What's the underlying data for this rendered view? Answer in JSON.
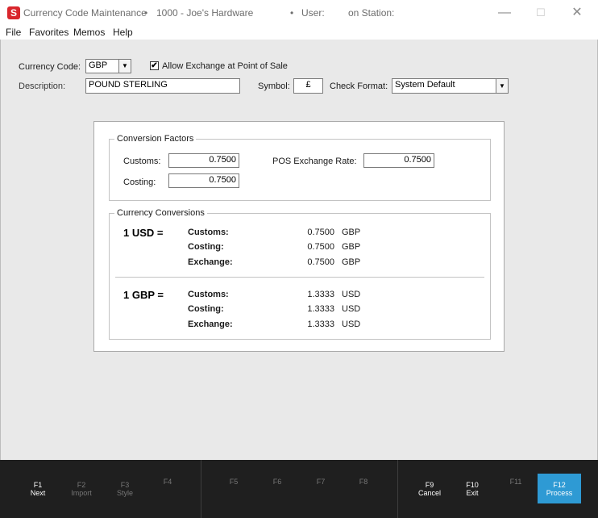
{
  "titlebar": {
    "app_icon": "S",
    "title": "Currency Code Maintenance",
    "sep1": "•",
    "store": "1000 - Joe's Hardware",
    "sep2": "•",
    "user_label": "User:",
    "station_label": "on Station:",
    "minimize": "—",
    "maximize": "☐",
    "close": "✕"
  },
  "menu": {
    "file": "File",
    "favorites": "Favorites",
    "memos": "Memos",
    "help": "Help"
  },
  "form": {
    "currency_code_label": "Currency Code:",
    "currency_code_value": "GBP",
    "allow_exchange_label": "Allow Exchange at Point of Sale",
    "allow_exchange_checked": "✔",
    "description_label": "Description:",
    "description_value": "POUND STERLING",
    "symbol_label": "Symbol:",
    "symbol_value": "£",
    "check_format_label": "Check Format:",
    "check_format_value": "System Default",
    "dropdown_arrow": "▼"
  },
  "conversion_factors": {
    "title": "Conversion Factors",
    "customs_label": "Customs:",
    "customs_value": "0.7500",
    "costing_label": "Costing:",
    "costing_value": "0.7500",
    "pos_rate_label": "POS Exchange Rate:",
    "pos_rate_value": "0.7500"
  },
  "currency_conversions": {
    "title": "Currency Conversions",
    "blocks": [
      {
        "heading": "1 USD =",
        "rows": [
          {
            "label": "Customs:",
            "value": "0.7500",
            "unit": "GBP"
          },
          {
            "label": "Costing:",
            "value": "0.7500",
            "unit": "GBP"
          },
          {
            "label": "Exchange:",
            "value": "0.7500",
            "unit": "GBP"
          }
        ]
      },
      {
        "heading": "1 GBP =",
        "rows": [
          {
            "label": "Customs:",
            "value": "1.3333",
            "unit": "USD"
          },
          {
            "label": "Costing:",
            "value": "1.3333",
            "unit": "USD"
          },
          {
            "label": "Exchange:",
            "value": "1.3333",
            "unit": "USD"
          }
        ]
      }
    ]
  },
  "fkeys": [
    {
      "key": "F1",
      "label": "Next"
    },
    {
      "key": "F2",
      "label": "Import"
    },
    {
      "key": "F3",
      "label": "Style"
    },
    {
      "key": "F4",
      "label": ""
    },
    {
      "key": "F5",
      "label": ""
    },
    {
      "key": "F6",
      "label": ""
    },
    {
      "key": "F7",
      "label": ""
    },
    {
      "key": "F8",
      "label": ""
    },
    {
      "key": "F9",
      "label": "Cancel"
    },
    {
      "key": "F10",
      "label": "Exit"
    },
    {
      "key": "F11",
      "label": ""
    },
    {
      "key": "F12",
      "label": "Process"
    }
  ],
  "colors": {
    "accent": "#2e9ad4",
    "app_icon": "#d9262c",
    "fkey_bar": "#1f1f1f",
    "background": "#e9e9e9"
  }
}
